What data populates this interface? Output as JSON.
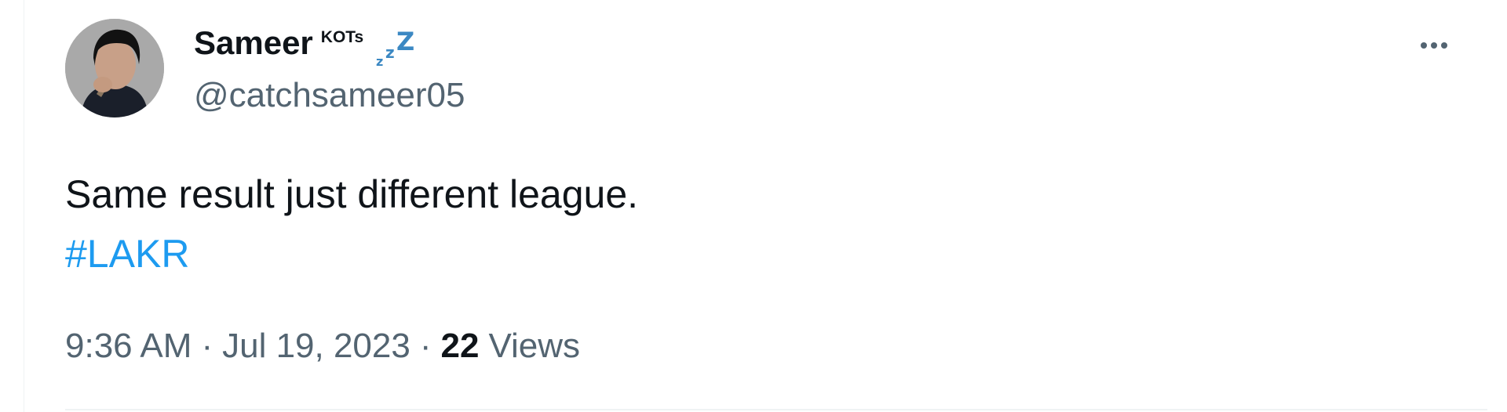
{
  "tweet": {
    "author": {
      "display_name": "Sameer",
      "name_suffix": "KOTs",
      "handle": "@catchsameer05",
      "avatar_icon": "profile-photo",
      "status_emoji_icon": "zzz-sleeping-icon"
    },
    "more_icon": "more-options-icon",
    "text": "Same result just different league.",
    "hashtag": "#LAKR",
    "meta": {
      "time": "9:36 AM",
      "separator": "·",
      "date": "Jul 19, 2023",
      "views_count": "22",
      "views_label": "Views"
    },
    "colors": {
      "text_primary": "#0f1419",
      "text_secondary": "#536471",
      "link": "#1d9bf0",
      "divider": "#eff3f4"
    }
  }
}
